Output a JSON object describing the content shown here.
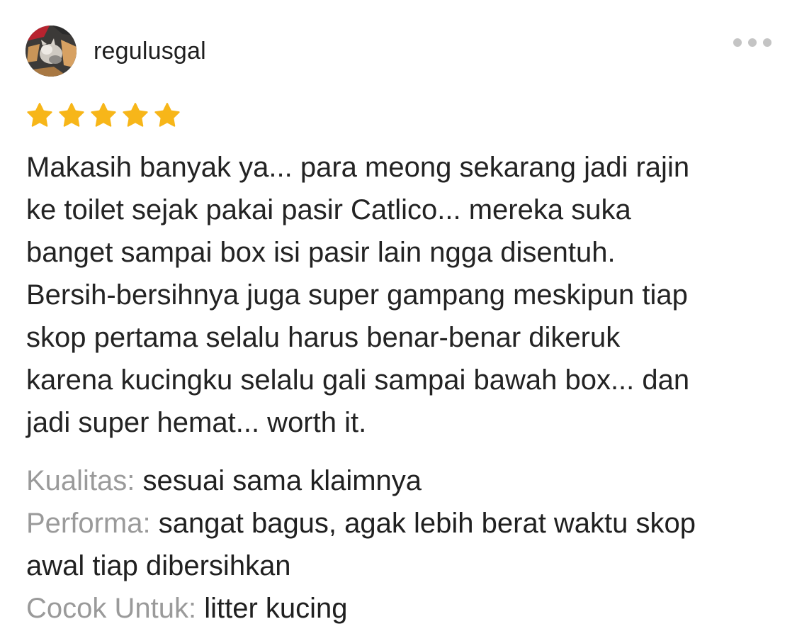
{
  "review": {
    "username": "regulusgal",
    "rating": 5,
    "rating_max": 5,
    "star_color": "#F7B619",
    "text_lines": [
      "Makasih banyak ya... para meong sekarang jadi rajin",
      "ke toilet sejak pakai pasir Catlico... mereka suka",
      "banget sampai box isi pasir lain ngga disentuh.",
      "Bersih-bersihnya juga super gampang meskipun tiap",
      "skop pertama selalu harus benar-benar dikeruk",
      "karena kucingku selalu gali sampai bawah box... dan",
      "jadi super hemat... worth it."
    ],
    "attributes": [
      {
        "label": "Kualitas:",
        "value": "sesuai sama klaimnya",
        "value_cont": ""
      },
      {
        "label": "Performa:",
        "value": "sangat bagus, agak lebih berat waktu skop",
        "value_cont": "awal tiap dibersihkan"
      },
      {
        "label": "Cocok Untuk:",
        "value": "litter kucing",
        "value_cont": ""
      }
    ]
  },
  "icons": {
    "more": "more-horizontal-icon",
    "star": "star-icon",
    "avatar": "cat-photo-avatar"
  },
  "colors": {
    "label_gray": "#9A9A9A",
    "text": "#222222",
    "dots": "#C4C4C4"
  }
}
